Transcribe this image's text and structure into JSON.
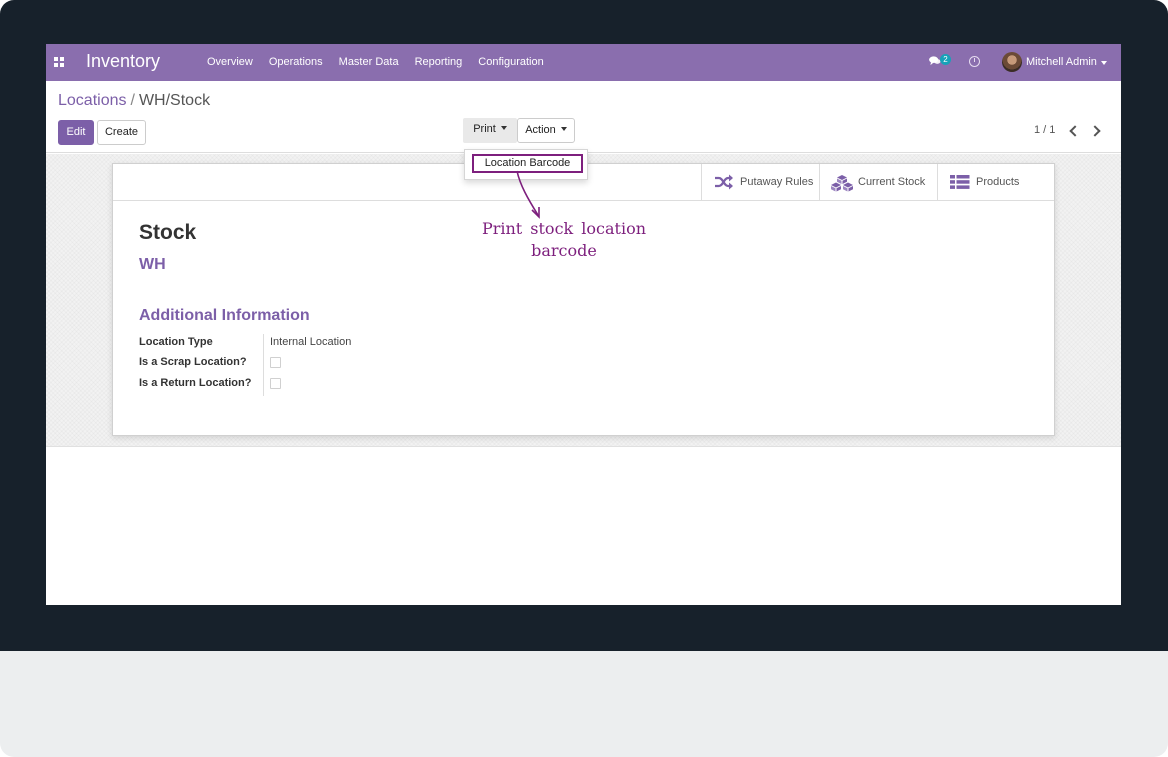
{
  "navbar": {
    "app_name": "Inventory",
    "menu": [
      "Overview",
      "Operations",
      "Master Data",
      "Reporting",
      "Configuration"
    ],
    "message_count": "2",
    "user_name": "Mitchell Admin",
    "color": "#8a6eae"
  },
  "breadcrumb": {
    "parent": "Locations",
    "separator": "/",
    "current": "WH/Stock"
  },
  "buttons": {
    "edit": "Edit",
    "create": "Create",
    "print": "Print",
    "action": "Action"
  },
  "pager": {
    "value": "1 / 1"
  },
  "print_menu": {
    "items": [
      "Location Barcode"
    ]
  },
  "smart_buttons": {
    "putaway": "Putaway Rules",
    "current_stock": "Current Stock",
    "products": "Products"
  },
  "record": {
    "name": "Stock",
    "parent": "WH",
    "section_title": "Additional Information",
    "fields": [
      {
        "label": "Location Type",
        "value": "Internal Location"
      },
      {
        "label": "Is a Scrap Location?",
        "checked": false
      },
      {
        "label": "Is a Return Location?",
        "checked": false
      }
    ]
  },
  "annotation": {
    "text": "Print stock location barcode",
    "color": "#7d1f7d"
  }
}
